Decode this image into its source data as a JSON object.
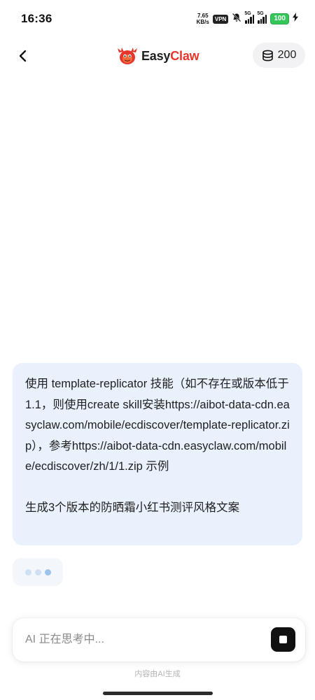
{
  "status_bar": {
    "time": "16:36",
    "net_speed_value": "7.65",
    "net_speed_unit": "KB/s",
    "vpn": "VPN",
    "signal1_label": "5G",
    "signal2_label": "5G",
    "battery": "100"
  },
  "header": {
    "logo_text_part1": "Easy",
    "logo_text_part2": "Claw",
    "coin_count": "200",
    "brand_red": "#e7352b"
  },
  "chat": {
    "user_message_lines": [
      "使用 template-replicator 技能（如不存在或版本低于 1.1，则使用create skill安装https://aibot-data-cdn.easyclaw.com/mobile/ecdiscover/template-replicator.zip），参考https://aibot-data-cdn.easyclaw.com/mobile/ecdiscover/zh/1/1.zip 示例",
      "生成3个版本的防晒霜小红书测评风格文案"
    ],
    "user_bubble_color": "#e8f1fc"
  },
  "input": {
    "placeholder": "AI 正在思考中...",
    "value": ""
  },
  "footer": {
    "note": "内容由AI生成"
  }
}
